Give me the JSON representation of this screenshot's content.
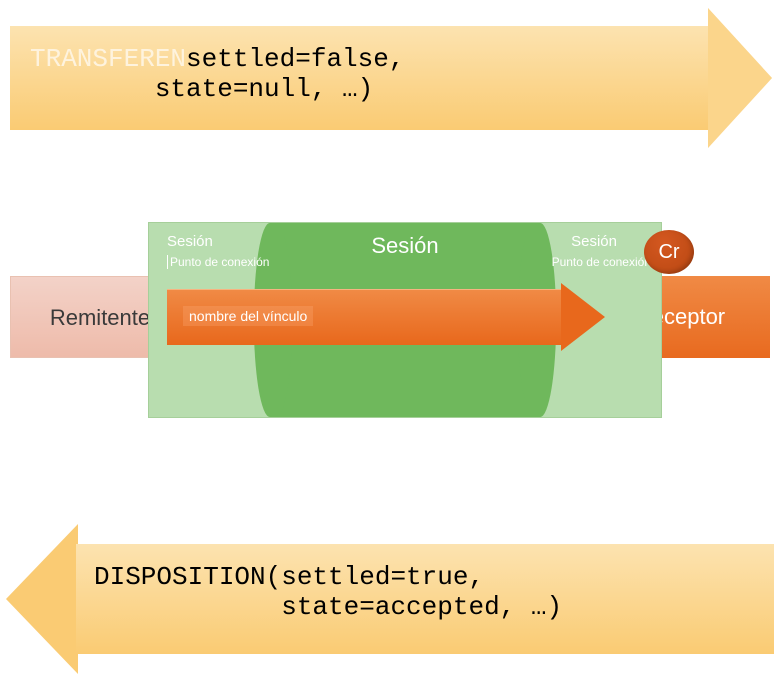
{
  "top_arrow": {
    "ghost_prefix": "TRANSFEREN",
    "line1_rest": "settled=false,",
    "line2": "        state=null, …)"
  },
  "middle": {
    "sender_label": "Remitente",
    "receiver_label": "Receptor",
    "session_left_title": "Sesión",
    "session_left_sub": "Punto de conexión",
    "session_center": "Sesión",
    "session_right_title": "Sesión",
    "session_right_sub": "Punto de conexión",
    "link_label": "nombre del vínculo",
    "cr_badge": "Cr"
  },
  "bottom_arrow": {
    "line1": "DISPOSITION(settled=true,",
    "line2": "            state=accepted, …)"
  }
}
